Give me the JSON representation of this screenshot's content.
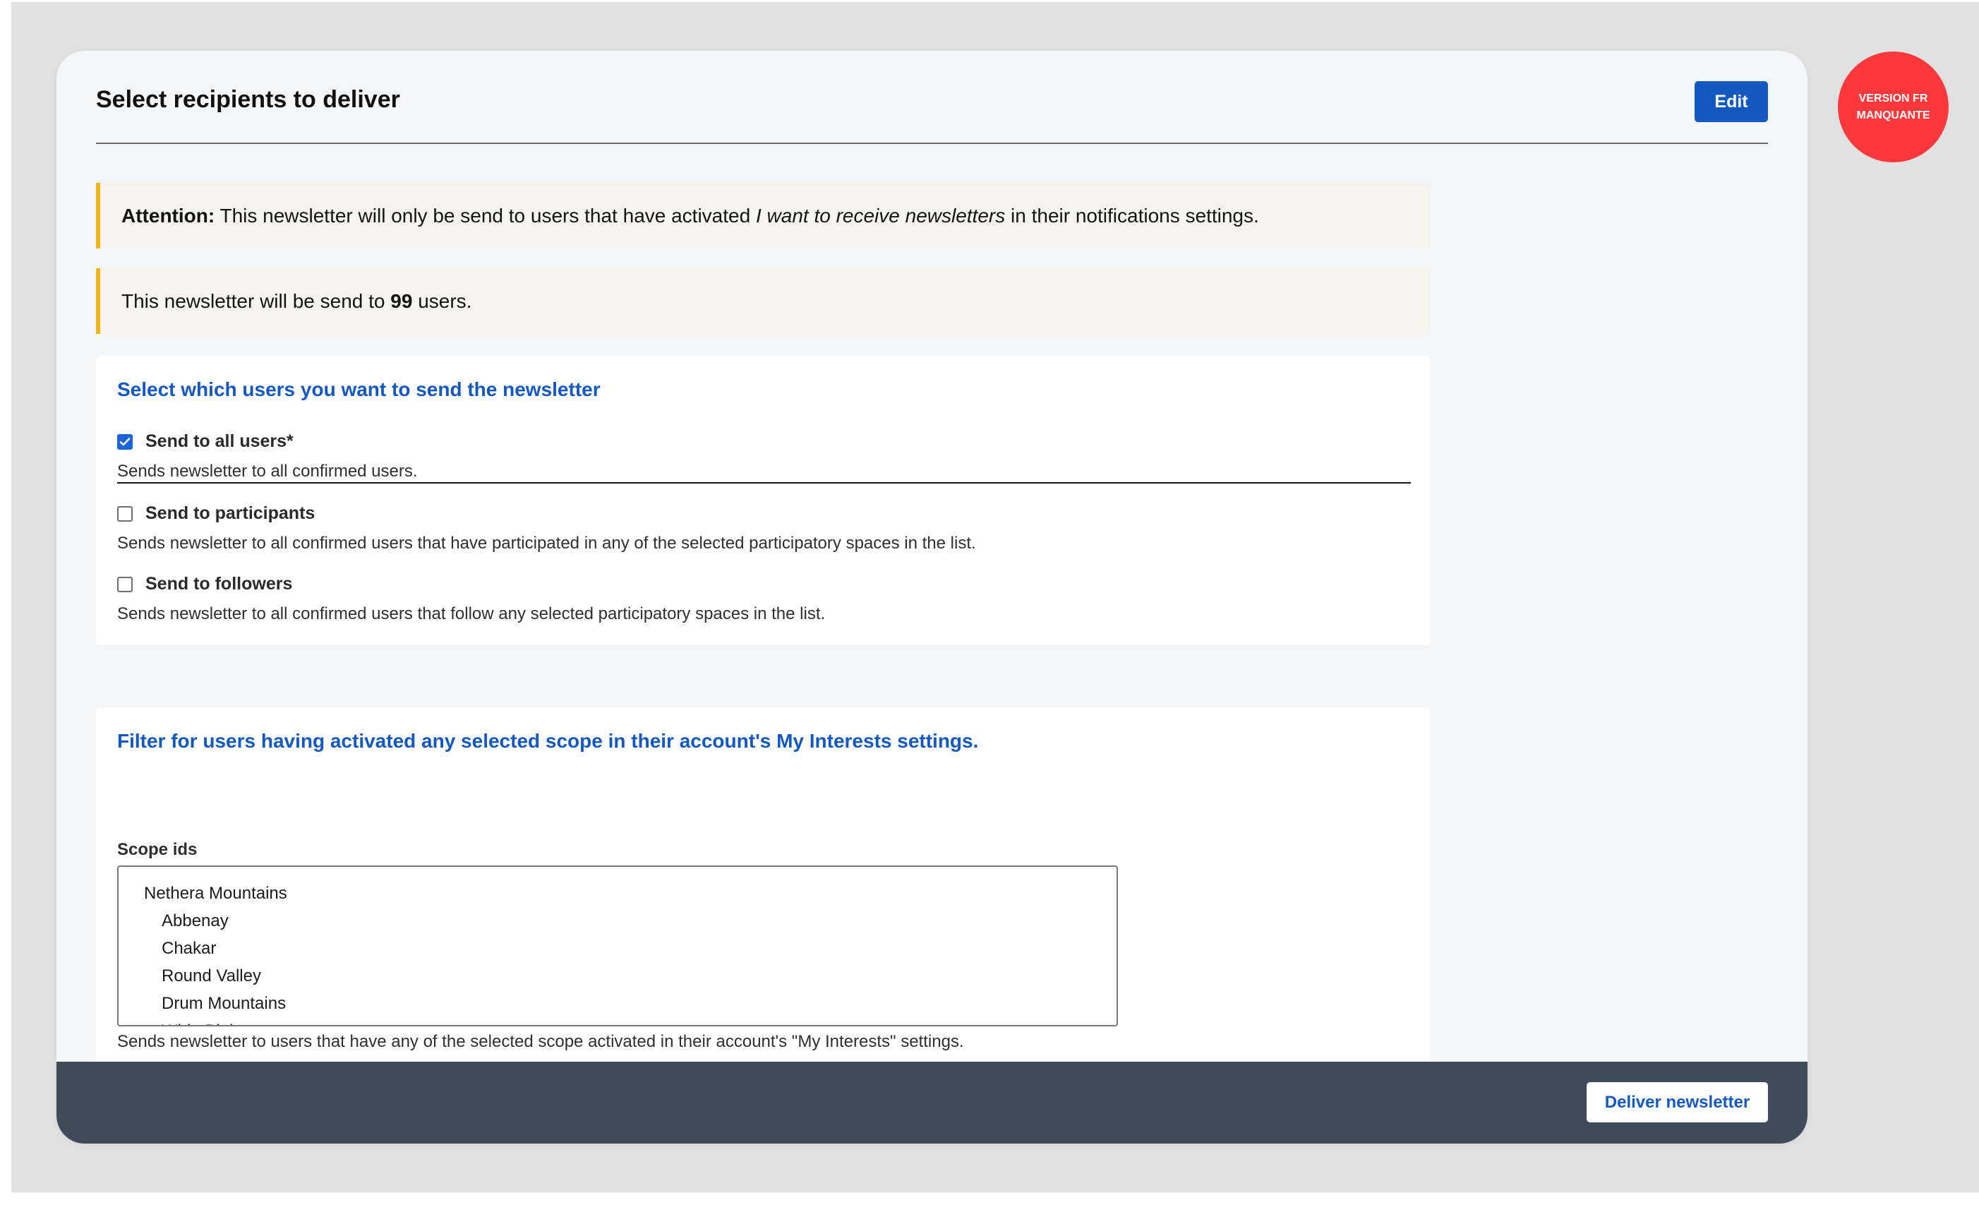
{
  "card": {
    "title": "Select recipients to deliver",
    "edit_label": "Edit"
  },
  "attention": {
    "label": "Attention:",
    "text_before": " This newsletter will only be send to users that have activated ",
    "setting_name": "I want to receive newsletters",
    "text_after": " in their notifications settings."
  },
  "recipient_count": {
    "text_before": "This newsletter will be send to ",
    "count": "99",
    "text_after": " users."
  },
  "recipients": {
    "heading": "Select which users you want to send the newsletter",
    "options": [
      {
        "label": "Send to all users*",
        "checked": true,
        "help": "Sends newsletter to all confirmed users."
      },
      {
        "label": "Send to participants",
        "checked": false,
        "help": "Sends newsletter to all confirmed users that have participated in any of the selected participatory spaces in the list."
      },
      {
        "label": "Send to followers",
        "checked": false,
        "help": "Sends newsletter to all confirmed users that follow any selected participatory spaces in the list."
      }
    ]
  },
  "scopes": {
    "heading": "Filter for users having activated any selected scope in their account's My Interests settings.",
    "field_label": "Scope ids",
    "items": [
      {
        "label": "Nethera Mountains",
        "level": 0
      },
      {
        "label": "Abbenay",
        "level": 1
      },
      {
        "label": "Chakar",
        "level": 1
      },
      {
        "label": "Round Valley",
        "level": 1
      },
      {
        "label": "Drum Mountains",
        "level": 1
      },
      {
        "label": "Wide Plains",
        "level": 1
      }
    ],
    "help": "Sends newsletter to users that have any of the selected scope activated in their account's \"My Interests\" settings."
  },
  "footer": {
    "deliver_label": "Deliver newsletter"
  },
  "badge": {
    "text": "VERSION FR MANQUANTE"
  },
  "colors": {
    "accent": "#1458c1",
    "callout_border": "#f3b51b",
    "footer": "#3f4a5a",
    "badge": "#fb383c"
  }
}
